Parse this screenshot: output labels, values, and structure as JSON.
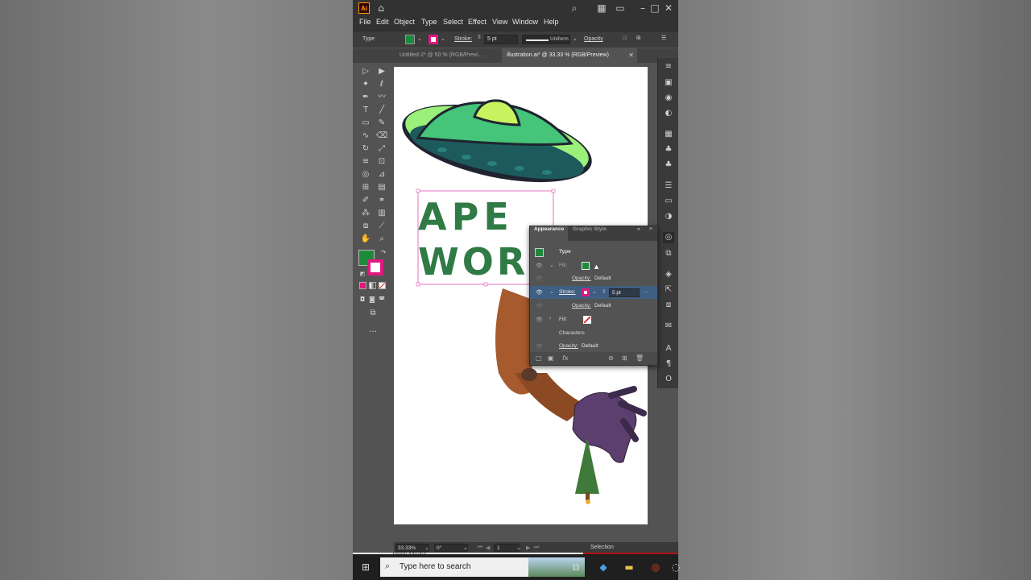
{
  "app": {
    "logo": "Ai",
    "menus": [
      "File",
      "Edit",
      "Object",
      "Type",
      "Select",
      "Effect",
      "View",
      "Window",
      "Help"
    ]
  },
  "control_bar": {
    "object_type": "Type",
    "stroke_label": "Stroke:",
    "stroke_weight": "5 pt",
    "stroke_profile": "Uniform",
    "opacity_label": "Opacity",
    "fill_color": "#1e8a3c",
    "stroke_color": "#e0187f"
  },
  "doc_tabs": [
    {
      "label": "Untitled-2* @ 50 % (RGB/Previ...",
      "active": false
    },
    {
      "label": "illustration.ai* @ 33.33 % (RGB/Preview)",
      "active": true
    }
  ],
  "artwork": {
    "headline_line1": "APE",
    "headline_line2": "WORL",
    "headline_color": "#2f7a45"
  },
  "appearance_panel": {
    "tabs": [
      "Appearance",
      "Graphic Style"
    ],
    "header": "Type",
    "rows": [
      {
        "label": "Fill:"
      },
      {
        "label": "Opacity:",
        "value": "Default"
      },
      {
        "label": "Stroke:",
        "value": "5 pt"
      },
      {
        "label": "Opacity:",
        "value": "Default"
      },
      {
        "label": "Fill:"
      },
      {
        "label": "Characters"
      },
      {
        "label": "Opacity:",
        "value": "Default"
      }
    ]
  },
  "status_bar": {
    "zoom": "33.33%",
    "rotation": "0°",
    "artboard_number": "1",
    "tool": "Selection"
  },
  "taskbar": {
    "search_placeholder": "Type here to search",
    "preview_text": "Think Media"
  }
}
